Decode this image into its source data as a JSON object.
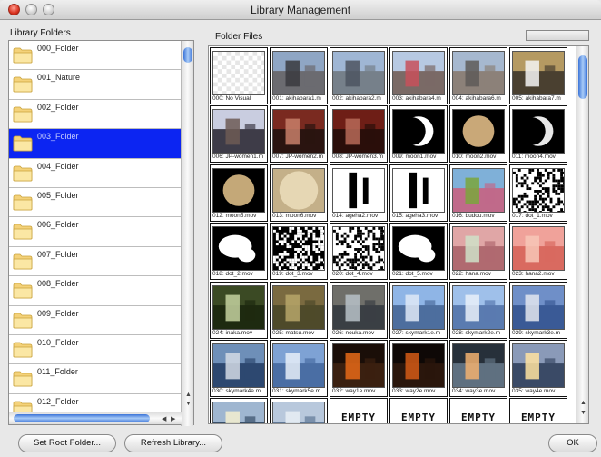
{
  "window": {
    "title": "Library Management"
  },
  "labels": {
    "library_folders": "Library Folders",
    "folder_files": "Folder Files"
  },
  "folders": [
    {
      "name": "000_Folder",
      "selected": false
    },
    {
      "name": "001_Nature",
      "selected": false
    },
    {
      "name": "002_Folder",
      "selected": false
    },
    {
      "name": "003_Folder",
      "selected": true
    },
    {
      "name": "004_Folder",
      "selected": false
    },
    {
      "name": "005_Folder",
      "selected": false
    },
    {
      "name": "006_Folder",
      "selected": false
    },
    {
      "name": "007_Folder",
      "selected": false
    },
    {
      "name": "008_Folder",
      "selected": false
    },
    {
      "name": "009_Folder",
      "selected": false
    },
    {
      "name": "010_Folder",
      "selected": false
    },
    {
      "name": "011_Folder",
      "selected": false
    },
    {
      "name": "012_Folder",
      "selected": false
    }
  ],
  "files": [
    {
      "caption": "000: No Visual",
      "kind": "checker",
      "colors": [
        "#e6e6e6",
        "#ffffff"
      ]
    },
    {
      "caption": "001: akihabara1.m",
      "kind": "photo",
      "colors": [
        "#8fa6c4",
        "#3a3a3e",
        "#6b6b70"
      ]
    },
    {
      "caption": "002: akihabara2.m",
      "kind": "photo",
      "colors": [
        "#9fb6d4",
        "#4d5560",
        "#76808a"
      ]
    },
    {
      "caption": "003: akihabara4.m",
      "kind": "photo",
      "colors": [
        "#b7c9e2",
        "#c8505a",
        "#7a6a66"
      ]
    },
    {
      "caption": "004: akihabara6.m",
      "kind": "photo",
      "colors": [
        "#a6b8cf",
        "#5e5a58",
        "#8c8179"
      ]
    },
    {
      "caption": "005: akihabara7.m",
      "kind": "photo",
      "colors": [
        "#b59a62",
        "#f4f4f4",
        "#4a4030"
      ]
    },
    {
      "caption": "006: JP-women1.m",
      "kind": "photo",
      "colors": [
        "#c9cde0",
        "#6d5a55",
        "#3e3c48"
      ]
    },
    {
      "caption": "007: JP-women2.m",
      "kind": "photo",
      "colors": [
        "#7a2a20",
        "#c87f6a",
        "#2a1410"
      ]
    },
    {
      "caption": "008: JP-women3.m",
      "kind": "photo",
      "colors": [
        "#6e1e16",
        "#b76a58",
        "#2a0e0a"
      ]
    },
    {
      "caption": "009: moon1.mov",
      "kind": "crescent",
      "colors": [
        "#000000",
        "#ffffff"
      ]
    },
    {
      "caption": "010: moon2.mov",
      "kind": "moon",
      "colors": [
        "#000000",
        "#c9a878"
      ]
    },
    {
      "caption": "011: moon4.mov",
      "kind": "crescent",
      "colors": [
        "#000000",
        "#e8e8e8"
      ]
    },
    {
      "caption": "012: moon5.mov",
      "kind": "moon",
      "colors": [
        "#000000",
        "#c4a878"
      ]
    },
    {
      "caption": "013: moon6.mov",
      "kind": "moon-full",
      "colors": [
        "#c4b089",
        "#e6d7b4"
      ]
    },
    {
      "caption": "014: ageha2.mov",
      "kind": "bw",
      "colors": [
        "#ffffff",
        "#000000"
      ]
    },
    {
      "caption": "015: ageha3.mov",
      "kind": "bw",
      "colors": [
        "#ffffff",
        "#000000"
      ]
    },
    {
      "caption": "016: budou.mov",
      "kind": "photo",
      "colors": [
        "#7fb0d8",
        "#7aa63c",
        "#c06a8a"
      ]
    },
    {
      "caption": "017: dot_1.mov",
      "kind": "noise",
      "colors": [
        "#ffffff",
        "#000000"
      ]
    },
    {
      "caption": "018: dot_2.mov",
      "kind": "blob",
      "colors": [
        "#000000",
        "#ffffff"
      ]
    },
    {
      "caption": "019: dot_3.mov",
      "kind": "noise",
      "colors": [
        "#000000",
        "#ffffff"
      ]
    },
    {
      "caption": "020: dot_4.mov",
      "kind": "noise",
      "colors": [
        "#ffffff",
        "#000000"
      ]
    },
    {
      "caption": "021: dot_5.mov",
      "kind": "blob",
      "colors": [
        "#000000",
        "#ffffff"
      ]
    },
    {
      "caption": "022: hana.mov",
      "kind": "photo",
      "colors": [
        "#e0a6a6",
        "#cfe0c8",
        "#b06a70"
      ]
    },
    {
      "caption": "023: hana2.mov",
      "kind": "photo",
      "colors": [
        "#f0a29a",
        "#f7c7b7",
        "#d96a60"
      ]
    },
    {
      "caption": "024: inaka.mov",
      "kind": "photo",
      "colors": [
        "#3b4a24",
        "#c6d2a0",
        "#1e2a10"
      ]
    },
    {
      "caption": "025: matsu.mov",
      "kind": "photo",
      "colors": [
        "#7a6a40",
        "#b7a66a",
        "#4e4a2a"
      ]
    },
    {
      "caption": "026: nouka.mov",
      "kind": "photo",
      "colors": [
        "#6f6f6a",
        "#b9c2c8",
        "#3a3f44"
      ]
    },
    {
      "caption": "027: skymark1e.m",
      "kind": "photo",
      "colors": [
        "#8fb5e6",
        "#dfe9f6",
        "#4d6e9e"
      ]
    },
    {
      "caption": "028: skymark2e.m",
      "kind": "photo",
      "colors": [
        "#9fc0ea",
        "#e9f0f9",
        "#5a7bb0"
      ]
    },
    {
      "caption": "029: skymark3e.m",
      "kind": "photo",
      "colors": [
        "#6f8fc8",
        "#e3e6ee",
        "#3a5a96"
      ]
    },
    {
      "caption": "030: skymark4e.m",
      "kind": "photo",
      "colors": [
        "#6e8fb8",
        "#d4dbe4",
        "#2d4870"
      ]
    },
    {
      "caption": "031: skymark5e.m",
      "kind": "photo",
      "colors": [
        "#7ea2d4",
        "#e6eef8",
        "#4a6ea4"
      ]
    },
    {
      "caption": "032: way1e.mov",
      "kind": "photo",
      "colors": [
        "#1a0e08",
        "#e86a18",
        "#3a2010"
      ]
    },
    {
      "caption": "033: way2e.mov",
      "kind": "photo",
      "colors": [
        "#0e0806",
        "#d35a16",
        "#2a160c"
      ]
    },
    {
      "caption": "034: way3e.mov",
      "kind": "photo",
      "colors": [
        "#27303a",
        "#f2b070",
        "#5f7080"
      ]
    },
    {
      "caption": "035: way4e.mov",
      "kind": "photo",
      "colors": [
        "#8a9ab8",
        "#ffe3a0",
        "#3a4a66"
      ]
    },
    {
      "caption": "",
      "kind": "photo",
      "colors": [
        "#9fb6d0",
        "#f5f0d0",
        "#39506a"
      ]
    },
    {
      "caption": "",
      "kind": "photo",
      "colors": [
        "#b8c8dc",
        "#e8eef4",
        "#607896"
      ]
    },
    {
      "caption": "",
      "kind": "empty",
      "text": "EMPTY",
      "colors": [
        "#ffffff",
        "#111111"
      ]
    },
    {
      "caption": "",
      "kind": "empty",
      "text": "EMPTY",
      "colors": [
        "#ffffff",
        "#111111"
      ]
    },
    {
      "caption": "",
      "kind": "empty",
      "text": "EMPTY",
      "colors": [
        "#ffffff",
        "#111111"
      ]
    },
    {
      "caption": "",
      "kind": "empty",
      "text": "EMPTY",
      "colors": [
        "#ffffff",
        "#111111"
      ]
    }
  ],
  "buttons": {
    "set_root": "Set Root Folder...",
    "refresh": "Refresh Library...",
    "ok": "OK"
  },
  "colors": {
    "selection": "#0c25f2",
    "scroll_thumb": "#3a73d8"
  },
  "icons": {
    "folder": "folder-icon"
  }
}
